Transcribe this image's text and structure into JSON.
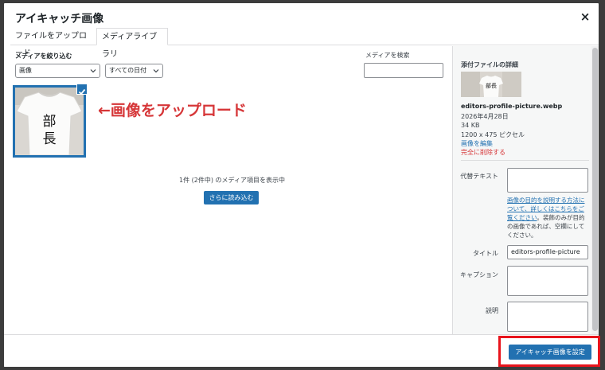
{
  "modal": {
    "title": "アイキャッチ画像",
    "close_label": "×"
  },
  "tabs": [
    {
      "label": "ファイルをアップロード"
    },
    {
      "label": "メディアライブラリ"
    }
  ],
  "filters": {
    "label": "メディアを絞り込む",
    "type_value": "画像",
    "date_value": "すべての日付"
  },
  "search": {
    "label": "メディアを検索",
    "value": ""
  },
  "annotation": {
    "text": "←画像をアップロード",
    "color": "#d63638"
  },
  "library": {
    "count_text": "1件 (2件中) のメディア項目を表示中",
    "load_more_label": "さらに読み込む",
    "shirt_text": "部長"
  },
  "sidebar": {
    "title": "添付ファイルの詳細",
    "filename": "editors-profile-picture.webp",
    "date": "2026年4月28日",
    "size": "34 KB",
    "dimensions": "1200 x 475 ピクセル",
    "edit_link": "画像を編集",
    "delete_link": "完全に削除する",
    "alt_label": "代替テキスト",
    "alt_value": "",
    "help_link": "画像の目的を説明する方法について、詳しくはこちらをご覧ください",
    "help_text": "。装飾のみが目的の画像であれば、空欄にしてください。",
    "title_label": "タイトル",
    "title_value": "editors-profile-picture",
    "caption_label": "キャプション",
    "caption_value": "",
    "description_label": "説明",
    "description_value": ""
  },
  "footer": {
    "set_button_label": "アイキャッチ画像を設定"
  },
  "colors": {
    "accent": "#2271b1",
    "annotation_red": "#e8141c",
    "danger": "#d63638"
  },
  "icons": {
    "close": "close-icon",
    "chevron": "chevron-down-icon",
    "check": "check-icon"
  }
}
